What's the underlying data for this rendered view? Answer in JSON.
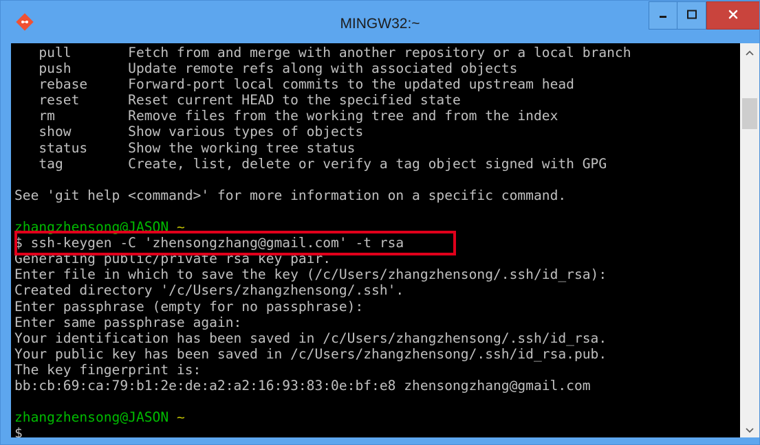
{
  "window": {
    "title": "MINGW32:~",
    "colors": {
      "frame": "#5da6ee",
      "close": "#c9443d",
      "terminal_bg": "#000000",
      "text": "#c0c0c0",
      "prompt_user": "#00bb00",
      "prompt_dir": "#c0c000",
      "highlight": "#e0001b"
    },
    "icons": {
      "app": "git-logo-icon",
      "minimize": "minimize-icon",
      "maximize": "maximize-icon",
      "close": "close-icon"
    }
  },
  "terminal": {
    "lines": [
      "   pull       Fetch from and merge with another repository or a local branch",
      "   push       Update remote refs along with associated objects",
      "   rebase     Forward-port local commits to the updated upstream head",
      "   reset      Reset current HEAD to the specified state",
      "   rm         Remove files from the working tree and from the index",
      "   show       Show various types of objects",
      "   status     Show the working tree status",
      "   tag        Create, list, delete or verify a tag object signed with GPG",
      "",
      "See 'git help <command>' for more information on a specific command."
    ],
    "blank_before_prompt1": "",
    "prompt1": {
      "user_host": "zhangzhensong@JASON",
      "dir": "~"
    },
    "command": "$ ssh-keygen -C 'zhensongzhang@gmail.com' -t rsa",
    "output": [
      "Generating public/private rsa key pair.",
      "Enter file in which to save the key (/c/Users/zhangzhensong/.ssh/id_rsa):",
      "Created directory '/c/Users/zhangzhensong/.ssh'.",
      "Enter passphrase (empty for no passphrase):",
      "Enter same passphrase again:",
      "Your identification has been saved in /c/Users/zhangzhensong/.ssh/id_rsa.",
      "Your public key has been saved in /c/Users/zhangzhensong/.ssh/id_rsa.pub.",
      "The key fingerprint is:",
      "bb:cb:69:ca:79:b1:2e:de:a2:a2:16:93:83:0e:bf:e8 zhensongzhang@gmail.com"
    ],
    "prompt2": {
      "user_host": "zhangzhensong@JASON",
      "dir": "~"
    },
    "cursor_line": "$"
  },
  "scrollbar": {
    "up_arrow": "chevron-up-icon",
    "down_arrow": "chevron-down-icon"
  }
}
